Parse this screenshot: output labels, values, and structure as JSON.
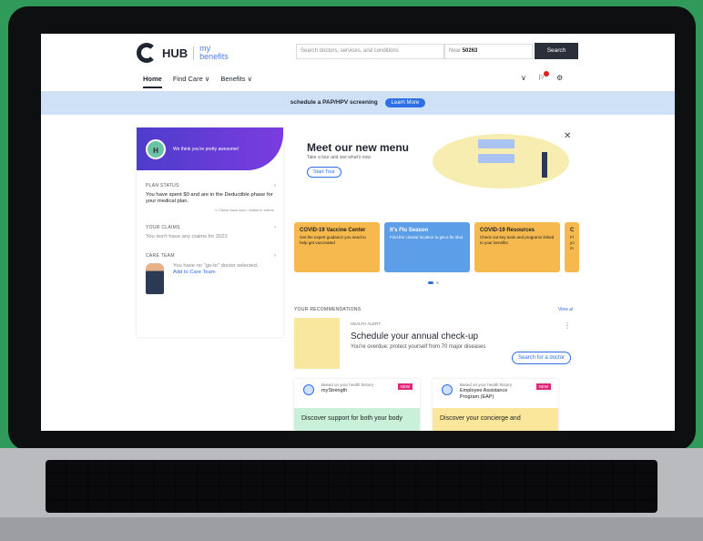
{
  "header": {
    "logo_hub": "HUB",
    "logo_my": "my",
    "logo_benefits": "benefits",
    "search_placeholder": "Search doctors, services, and conditions",
    "near_label": "Near",
    "near_zip": "50263",
    "search_button": "Search",
    "nav": [
      "Home",
      "Find Care ∨",
      "Benefits ∨"
    ]
  },
  "banner": {
    "text": "schedule a PAP/HPV screening",
    "button": "Learn More"
  },
  "profile": {
    "initials": "H",
    "greeting": "We think you're pretty awesome!"
  },
  "plan_status": {
    "title": "PLAN STATUS",
    "line": "You have spent $0 and are in the Deductible phase for your medical plan.",
    "note": "⚠ Check back soon: visible in xxtime"
  },
  "claims": {
    "title": "YOUR CLAIMS",
    "text": "You don't have any claims for 2022"
  },
  "care_team": {
    "title": "CARE TEAM",
    "text": "You have no \"go-to\" doctor selected.",
    "link": "Add to Care Team"
  },
  "menu": {
    "title": "Meet our new menu",
    "subtitle": "Take a tour and see what's now",
    "button": "Start Tour"
  },
  "cards": [
    {
      "title": "COVID-19 Vaccine Center",
      "text": "Get the expert guidance you need to help get vaccinated"
    },
    {
      "title": "It's Flu Season",
      "text": "Find the closest location to get a flu shot"
    },
    {
      "title": "COVID-19 Resources",
      "text": "Check out key tools and programs linked to your benefits"
    },
    {
      "title": "C",
      "text": "Fl yo m"
    }
  ],
  "recommendations": {
    "title": "YOUR RECOMMENDATIONS",
    "view_all": "View al",
    "alert_kicker": "HEALTH ALERT",
    "alert_title": "Schedule your annual check-up",
    "alert_sub": "You're overdue: protect yourself from 70 major diseases",
    "alert_button": "Search for a doctor",
    "small_cards": [
      {
        "kicker": "Based on your health history",
        "title": "myStrength",
        "badge": "NEW",
        "footer": "Discover support for both your body"
      },
      {
        "kicker": "Based on your health history",
        "title": "Employee Assistance Program (EAP)",
        "badge": "NEW",
        "footer": "Discover your concierge and"
      }
    ]
  },
  "colors": {
    "accent": "#2e6fe8",
    "banner": "#cfe1f7",
    "purple": "#5a3ccf",
    "orange": "#f6b94e"
  }
}
